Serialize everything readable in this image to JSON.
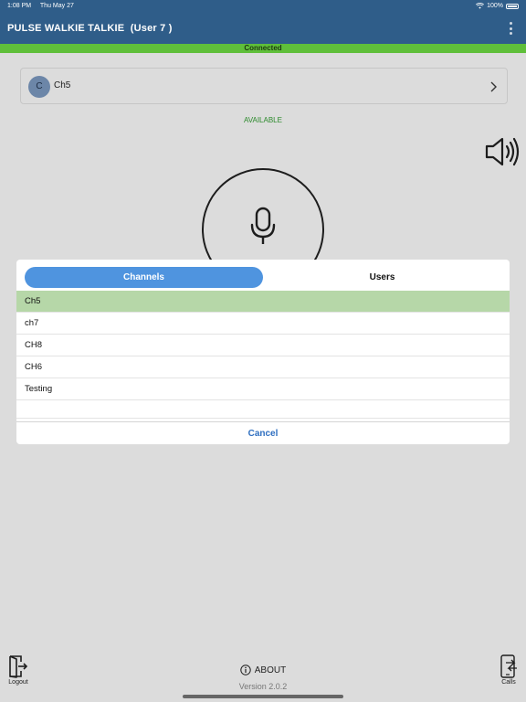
{
  "status_bar": {
    "time": "1:08 PM",
    "date": "Thu May 27",
    "battery": "100%",
    "wifi_icon": "wifi-icon",
    "battery_icon": "battery-icon"
  },
  "header": {
    "title": "PULSE WALKIE TALKIE  (User 7 )",
    "menu_icon": "kebab-menu-icon"
  },
  "connection": {
    "status": "Connected",
    "color": "#5fbf3a"
  },
  "channel_card": {
    "avatar_letter": "C",
    "name": "Ch5",
    "chevron_icon": "chevron-right-icon"
  },
  "availability": {
    "text": "AVAILABLE",
    "color": "#2c8a2c"
  },
  "controls": {
    "speaker_icon": "speaker-volume-icon",
    "mic_icon": "microphone-icon"
  },
  "modal": {
    "tabs": [
      {
        "label": "Channels",
        "selected": true
      },
      {
        "label": "Users",
        "selected": false
      }
    ],
    "channels": [
      {
        "name": "Ch5",
        "selected": true
      },
      {
        "name": "ch7"
      },
      {
        "name": "CH8"
      },
      {
        "name": "CH6"
      },
      {
        "name": "Testing"
      }
    ],
    "cancel_label": "Cancel",
    "accent": "#4f94df",
    "selected_row_color": "#b6d7a8"
  },
  "footer": {
    "logout_label": "Logout",
    "about_label": "ABOUT",
    "version": "Version 2.0.2",
    "calls_label": "Calls",
    "logout_icon": "logout-door-icon",
    "info_icon": "info-icon",
    "calls_icon": "phone-transfer-icon"
  }
}
